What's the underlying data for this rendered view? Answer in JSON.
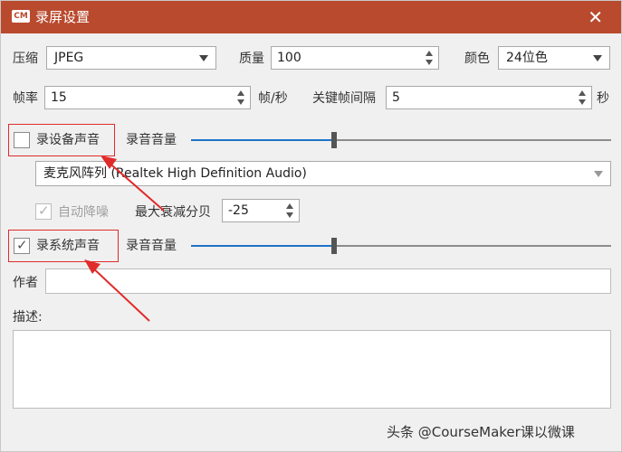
{
  "window": {
    "title": "录屏设置",
    "logo_text": "CM",
    "close_symbol": "✕",
    "title_bar_color": "#b94a2e"
  },
  "compression": {
    "label": "压缩",
    "value": "JPEG"
  },
  "quality": {
    "label": "质量",
    "value": "100"
  },
  "color": {
    "label": "颜色",
    "value": "24位色"
  },
  "framerate": {
    "label": "帧率",
    "value": "15",
    "unit": "帧/秒"
  },
  "keyframe": {
    "label": "关键帧间隔",
    "value": "5",
    "unit": "秒"
  },
  "record_device_audio": {
    "label": "录设备声音",
    "checked": false,
    "volume_label": "录音音量",
    "volume_level": 0.34
  },
  "device": {
    "value": "麦克风阵列 (Realtek High Definition Audio)"
  },
  "auto_denoise": {
    "label": "自动降噪",
    "checked": true,
    "enabled": false
  },
  "max_attenuation": {
    "label": "最大衰减分贝",
    "value": "-25"
  },
  "record_system_audio": {
    "label": "录系统声音",
    "checked": true,
    "volume_label": "录音音量",
    "volume_level": 0.34
  },
  "author": {
    "label": "作者",
    "value": ""
  },
  "description": {
    "label": "描述:",
    "value": ""
  },
  "watermark": "头条 @CourseMaker课以微课",
  "annotation_color": "#e02b2b"
}
